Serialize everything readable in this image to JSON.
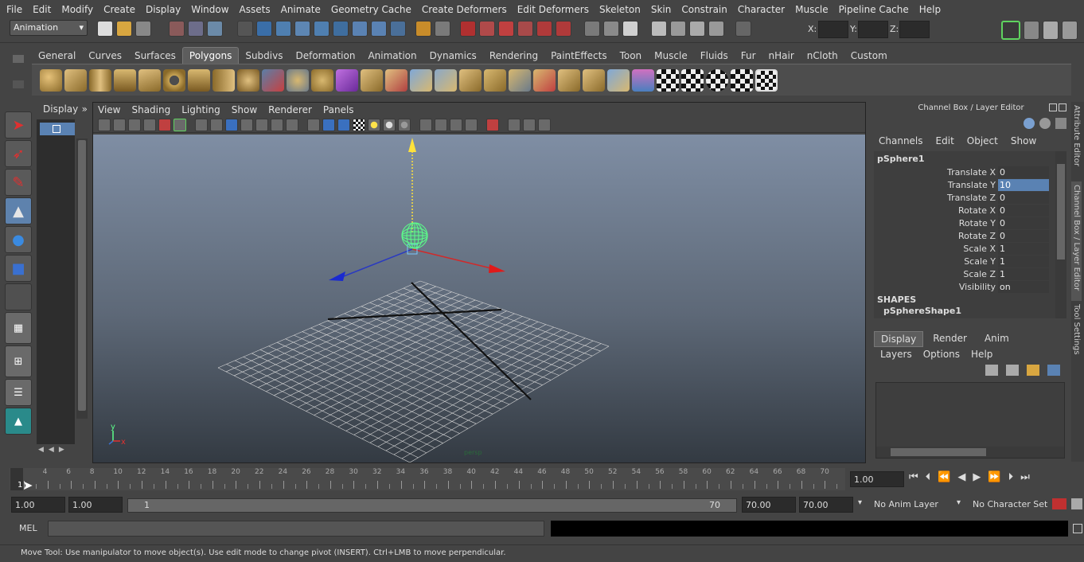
{
  "menubar": [
    "File",
    "Edit",
    "Modify",
    "Create",
    "Display",
    "Window",
    "Assets",
    "Animate",
    "Geometry Cache",
    "Create Deformers",
    "Edit Deformers",
    "Skeleton",
    "Skin",
    "Constrain",
    "Character",
    "Muscle",
    "Pipeline Cache",
    "Help"
  ],
  "status": {
    "mode": "Animation",
    "x_label": "X:",
    "y_label": "Y:",
    "z_label": "Z:"
  },
  "shelf_tabs": [
    "General",
    "Curves",
    "Surfaces",
    "Polygons",
    "Subdivs",
    "Deformation",
    "Animation",
    "Dynamics",
    "Rendering",
    "PaintEffects",
    "Toon",
    "Muscle",
    "Fluids",
    "Fur",
    "nHair",
    "nCloth",
    "Custom"
  ],
  "shelf_active": "Polygons",
  "outliner": {
    "display": "Display",
    "more": "»"
  },
  "viewport": {
    "menus": [
      "View",
      "Shading",
      "Lighting",
      "Show",
      "Renderer",
      "Panels"
    ],
    "axis_y": "y",
    "axis_x": "x",
    "cam_label": "persp"
  },
  "channelbox": {
    "title": "Channel Box / Layer Editor",
    "menus": [
      "Channels",
      "Edit",
      "Object",
      "Show"
    ],
    "object": "pSphere1",
    "attrs": [
      {
        "name": "Translate X",
        "value": "0"
      },
      {
        "name": "Translate Y",
        "value": "10"
      },
      {
        "name": "Translate Z",
        "value": "0"
      },
      {
        "name": "Rotate X",
        "value": "0"
      },
      {
        "name": "Rotate Y",
        "value": "0"
      },
      {
        "name": "Rotate Z",
        "value": "0"
      },
      {
        "name": "Scale X",
        "value": "1"
      },
      {
        "name": "Scale Y",
        "value": "1"
      },
      {
        "name": "Scale Z",
        "value": "1"
      },
      {
        "name": "Visibility",
        "value": "on"
      }
    ],
    "shapes_label": "SHAPES",
    "shape": "pSphereShape1",
    "layer_tabs": [
      "Display",
      "Render",
      "Anim"
    ],
    "layer_menus": [
      "Layers",
      "Options",
      "Help"
    ]
  },
  "side_tabs": [
    "Attribute Editor",
    "Channel Box / Layer Editor",
    "Tool Settings"
  ],
  "timeline": {
    "ticks": [
      "2",
      "4",
      "6",
      "8",
      "10",
      "12",
      "14",
      "16",
      "18",
      "20",
      "22",
      "24",
      "26",
      "28",
      "30",
      "32",
      "34",
      "36",
      "38",
      "40",
      "42",
      "44",
      "46",
      "48",
      "50",
      "52",
      "54",
      "56",
      "58",
      "60",
      "62",
      "64",
      "66",
      "68",
      "70"
    ],
    "current": "1",
    "current_field": "1.00"
  },
  "range": {
    "start": "1.00",
    "start2": "1.00",
    "slider_start": "1",
    "slider_end": "70",
    "end": "70.00",
    "end2": "70.00",
    "anim_layer": "No Anim Layer",
    "char_set": "No Character Set"
  },
  "cmd": {
    "label": "MEL"
  },
  "help": "Move Tool: Use manipulator to move object(s). Use edit mode to change pivot (INSERT).  Ctrl+LMB to move perpendicular."
}
